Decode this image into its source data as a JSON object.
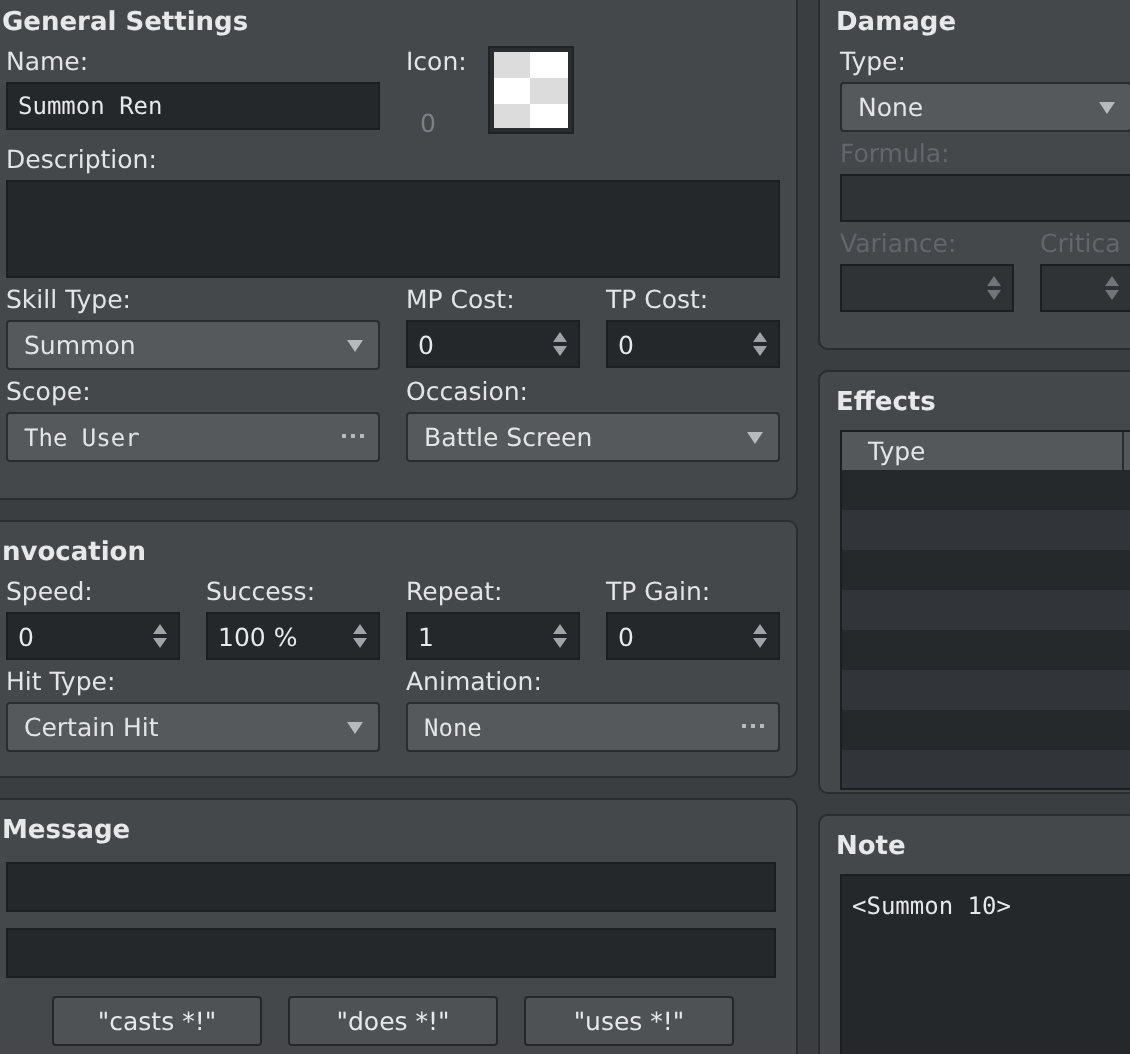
{
  "general_settings": {
    "title": "General Settings",
    "fields": [
      {
        "kind": "text",
        "label": "Name:",
        "value": "Summon Ren",
        "disabled": false
      },
      {
        "kind": "icon",
        "label": "Icon:",
        "value": "0",
        "disabled": false
      },
      {
        "kind": "textarea",
        "label": "Description:",
        "disabled": false
      },
      {
        "kind": "dropdown",
        "label": "Skill Type:",
        "value": "Summon",
        "disabled": false
      },
      {
        "kind": "spin",
        "label": "MP Cost:",
        "value": "0",
        "disabled": false
      },
      {
        "kind": "spin",
        "label": "TP Cost:",
        "value": "0",
        "disabled": false
      },
      {
        "kind": "picker",
        "label": "Scope:",
        "value": "The User",
        "disabled": false
      },
      {
        "kind": "dropdown",
        "label": "Occasion:",
        "value": "Battle Screen",
        "disabled": false
      }
    ]
  },
  "invocation": {
    "title": "nvocation",
    "fields": [
      {
        "kind": "spin",
        "label": "Speed:",
        "value": "0",
        "disabled": false
      },
      {
        "kind": "spin",
        "label": "Success:",
        "value": "100 %",
        "disabled": false
      },
      {
        "kind": "spin",
        "label": "Repeat:",
        "value": "1",
        "disabled": false
      },
      {
        "kind": "spin",
        "label": "TP Gain:",
        "value": "0",
        "disabled": false
      },
      {
        "kind": "dropdown",
        "label": "Hit Type:",
        "value": "Certain Hit",
        "disabled": false
      },
      {
        "kind": "picker",
        "label": "Animation:",
        "value": "None",
        "disabled": false
      }
    ]
  },
  "message": {
    "title": "Message",
    "buttons": [
      "\"casts *!\"",
      "\"does *!\"",
      "\"uses *!\""
    ]
  },
  "damage": {
    "title": "Damage",
    "fields": [
      {
        "kind": "dropdown",
        "label": "Type:",
        "value": "None",
        "disabled": false
      },
      {
        "kind": "text",
        "label": "Formula:",
        "disabled": true
      },
      {
        "kind": "spin",
        "label": "Variance:",
        "disabled": true
      },
      {
        "kind": "spin",
        "label": "Critica",
        "disabled": true
      }
    ]
  },
  "effects": {
    "title": "Effects",
    "columns": [
      "Type"
    ]
  },
  "note": {
    "title": "Note",
    "text": "<Summon 10>"
  }
}
